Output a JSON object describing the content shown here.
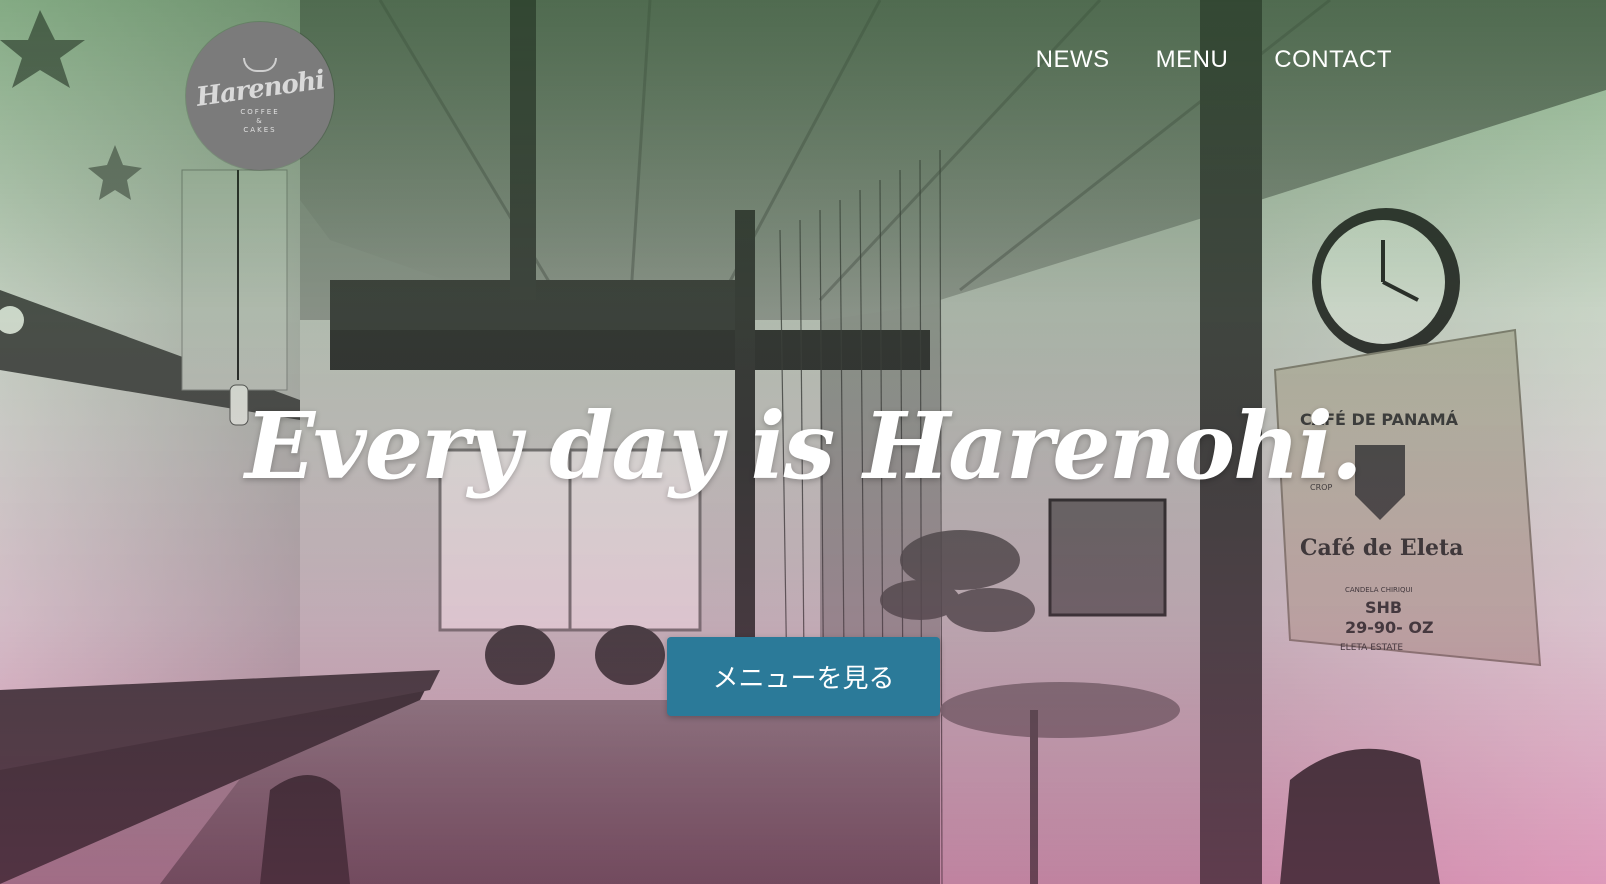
{
  "logo": {
    "script": "Harenohi",
    "sub_line1": "COFFEE",
    "sub_line2": "&",
    "sub_line3": "CAKES"
  },
  "nav": {
    "items": [
      {
        "label": "NEWS"
      },
      {
        "label": "MENU"
      },
      {
        "label": "CONTACT"
      }
    ]
  },
  "hero": {
    "headline": "Every day is Harenohi.",
    "cta_label": "メニューを見る"
  },
  "scene": {
    "sack_line1": "CAFÉ DE PANAMÁ",
    "sack_line2": "CROP",
    "sack_line3": "Café de Eleta",
    "sack_line4": "CANDELA CHIRIQUI",
    "sack_line5": "SHB",
    "sack_line6": "29-90- OZ",
    "sack_line7": "ELETA   ESTATE"
  },
  "colors": {
    "cta_bg": "#2b7a99",
    "overlay_top": "#3c783c",
    "overlay_bottom": "#c85a8c"
  }
}
